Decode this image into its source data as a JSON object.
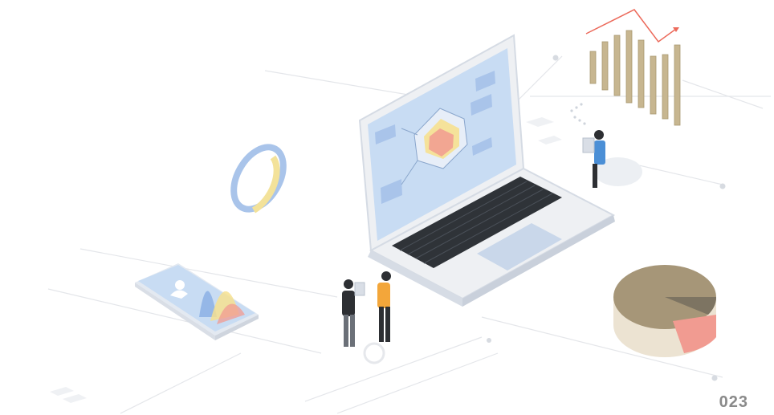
{
  "page_number": "023",
  "colors": {
    "background": "#ffffff",
    "line": "#e4e6ea",
    "laptop_body": "#eef0f3",
    "laptop_edge": "#d5dbe4",
    "screen": "#c8dcf3",
    "keys": "#2f3338",
    "trackpad": "#c9d7ea",
    "accent_blue": "#a9c4ea",
    "accent_yellow": "#f6e4a0",
    "accent_red": "#f19b91",
    "bar_tan": "#c7b690",
    "trend_red": "#ec6a5b",
    "pie_main": "#a69678",
    "pie_dark": "#7d7462",
    "pie_side": "#ece3d2",
    "person_dark": "#2d2f33",
    "person_orange": "#f3a63a",
    "person_blue": "#4b8fd6"
  },
  "icons": [
    "laptop-icon",
    "radar-chart-icon",
    "bar-chart-icon",
    "pie-chart-icon",
    "ring-chart-icon",
    "smartphone-icon",
    "user-icon",
    "gear-icon",
    "person-icon"
  ]
}
